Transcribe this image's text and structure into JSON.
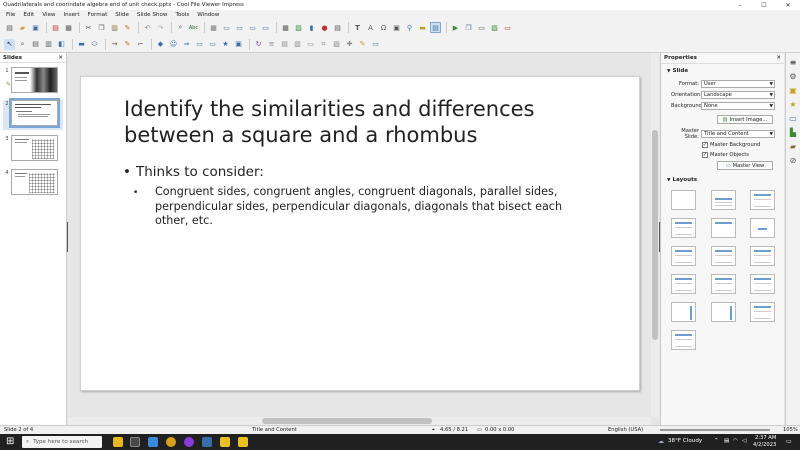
{
  "window": {
    "title": "Quadrilaterals and coorindate algebra end of unit check.pptx - Cool File Viewer Impress",
    "minimize": "–",
    "maximize": "☐",
    "close": "✕"
  },
  "menubar": [
    "File",
    "Edit",
    "View",
    "Insert",
    "Format",
    "Slide",
    "Slide Show",
    "Tools",
    "Window"
  ],
  "slides_panel": {
    "title": "Slides",
    "close": "✕",
    "numbers": [
      "1",
      "2",
      "3",
      "4"
    ]
  },
  "slide": {
    "title": "Identify the similarities and differences between a square and a rhombus",
    "bullet_char": "•",
    "bullet1": "Thinks to consider:",
    "bullet2": "Congruent sides, congruent angles, congruent diagonals, parallel sides, perpendicular sides, perpendicular diagonals, diagonals that bisect each other, etc."
  },
  "properties": {
    "title": "Properties",
    "close": "✕",
    "section_slide": "Slide",
    "format_label": "Format:",
    "format_value": "User",
    "orientation_label": "Orientation:",
    "orientation_value": "Landscape",
    "background_label": "Background:",
    "background_value": "None",
    "insert_image": "Insert Image...",
    "master_slide_label": "Master Slide:",
    "master_slide_value": "Title and Content",
    "master_background": "Master Background",
    "master_objects": "Master Objects",
    "master_view": "Master View",
    "section_layouts": "Layouts"
  },
  "statusbar": {
    "slide_pos": "Slide 2 of 4",
    "layout": "Title and Content",
    "position": "4.65 / 8.21",
    "size": "0.00 x 0.00",
    "language": "English (USA)",
    "zoom": "105%"
  },
  "taskbar": {
    "search_placeholder": "Type here to search",
    "weather": "38°F  Cloudy",
    "time": "2:37 AM",
    "date": "4/2/2023"
  },
  "colors": {
    "accent": "#6a9fd0",
    "selected_bg": "#dbe7f4",
    "taskbar": "#202020"
  }
}
